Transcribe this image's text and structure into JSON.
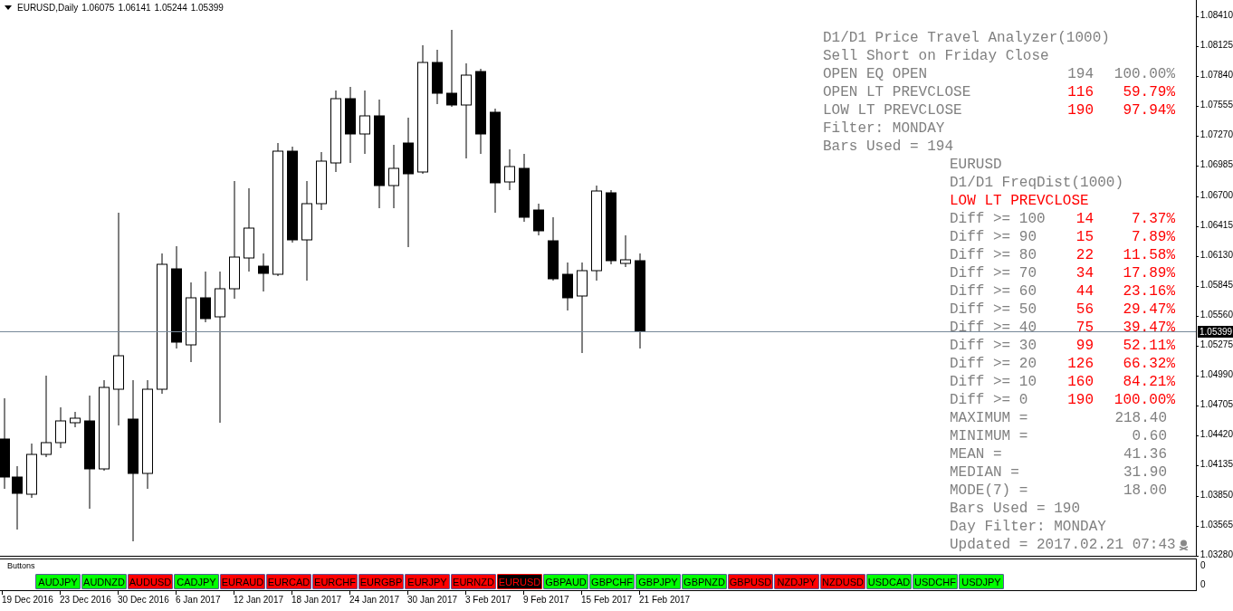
{
  "chart_window": {
    "title": "EURUSD,Daily",
    "ohlc": [
      "1.06075",
      "1.06141",
      "1.05244",
      "1.05399"
    ]
  },
  "analyzer": {
    "title": "D1/D1 Price Travel Analyzer(1000)",
    "subtitle": "Sell Short on Friday Close",
    "rows": [
      {
        "label": "OPEN EQ OPEN",
        "count": "194",
        "percent": "100.00%",
        "color": "#808080"
      },
      {
        "label": "OPEN LT PREVCLOSE",
        "count": "116",
        "percent": "59.79%",
        "color": "#ff0000"
      },
      {
        "label": "LOW LT PREVCLOSE",
        "count": "190",
        "percent": "97.94%",
        "color": "#ff0000"
      }
    ],
    "filter": "Filter: MONDAY",
    "bars_used": "Bars Used = 194"
  },
  "freq_dist": {
    "symbol": "EURUSD",
    "title": "D1/D1 FreqDist(1000)",
    "condition": "LOW LT PREVCLOSE",
    "rows": [
      {
        "label": "Diff >= 100",
        "count": "14",
        "percent": "7.37%"
      },
      {
        "label": "Diff >= 90",
        "count": "15",
        "percent": "7.89%"
      },
      {
        "label": "Diff >= 80",
        "count": "22",
        "percent": "11.58%"
      },
      {
        "label": "Diff >= 70",
        "count": "34",
        "percent": "17.89%"
      },
      {
        "label": "Diff >= 60",
        "count": "44",
        "percent": "23.16%"
      },
      {
        "label": "Diff >= 50",
        "count": "56",
        "percent": "29.47%"
      },
      {
        "label": "Diff >= 40",
        "count": "75",
        "percent": "39.47%"
      },
      {
        "label": "Diff >= 30",
        "count": "99",
        "percent": "52.11%"
      },
      {
        "label": "Diff >= 20",
        "count": "126",
        "percent": "66.32%"
      },
      {
        "label": "Diff >= 10",
        "count": "160",
        "percent": "84.21%"
      },
      {
        "label": "Diff >= 0",
        "count": "190",
        "percent": "100.00%"
      }
    ],
    "stats": [
      {
        "label": "MAXIMUM =",
        "value": "218.40"
      },
      {
        "label": "MINIMUM =",
        "value": "0.60"
      },
      {
        "label": "MEAN =",
        "value": "41.36"
      },
      {
        "label": "MEDIAN =",
        "value": "31.90"
      },
      {
        "label": "MODE(7) =",
        "value": "18.00"
      }
    ],
    "bars_used": "Bars Used = 190",
    "day_filter": "Day Filter: MONDAY",
    "updated": "Updated = 2017.02.21 07:43"
  },
  "price_axis": [
    "1.08410",
    "1.08125",
    "1.07840",
    "1.07555",
    "1.07270",
    "1.06985",
    "1.06700",
    "1.06415",
    "1.06130",
    "1.05845",
    "1.05560",
    "1.05275",
    "1.04990",
    "1.04705",
    "1.04420",
    "1.04135",
    "1.03850",
    "1.03565",
    "1.03280"
  ],
  "current_price": "1.05399",
  "buttons_window": {
    "title": "Buttons",
    "axis": [
      "0",
      "0"
    ],
    "buttons": [
      {
        "label": "AUDJPY",
        "color": "#00ff00",
        "selected": false
      },
      {
        "label": "AUDNZD",
        "color": "#00ff00",
        "selected": false
      },
      {
        "label": "AUDUSD",
        "color": "#ff0000",
        "selected": false
      },
      {
        "label": "CADJPY",
        "color": "#00ff00",
        "selected": false
      },
      {
        "label": "EURAUD",
        "color": "#ff0000",
        "selected": false
      },
      {
        "label": "EURCAD",
        "color": "#ff0000",
        "selected": false
      },
      {
        "label": "EURCHF",
        "color": "#ff0000",
        "selected": false
      },
      {
        "label": "EURGBP",
        "color": "#ff0000",
        "selected": false
      },
      {
        "label": "EURJPY",
        "color": "#ff0000",
        "selected": false
      },
      {
        "label": "EURNZD",
        "color": "#ff0000",
        "selected": false
      },
      {
        "label": "EURUSD",
        "color": "#ff0000",
        "selected": true
      },
      {
        "label": "GBPAUD",
        "color": "#00ff00",
        "selected": false
      },
      {
        "label": "GBPCHF",
        "color": "#00ff00",
        "selected": false
      },
      {
        "label": "GBPJPY",
        "color": "#00ff00",
        "selected": false
      },
      {
        "label": "GBPNZD",
        "color": "#00ff00",
        "selected": false
      },
      {
        "label": "GBPUSD",
        "color": "#ff0000",
        "selected": false
      },
      {
        "label": "NZDJPY",
        "color": "#ff0000",
        "selected": false
      },
      {
        "label": "NZDUSD",
        "color": "#ff0000",
        "selected": false
      },
      {
        "label": "USDCAD",
        "color": "#00ff00",
        "selected": false
      },
      {
        "label": "USDCHF",
        "color": "#00ff00",
        "selected": false
      },
      {
        "label": "USDJPY",
        "color": "#00ff00",
        "selected": false
      }
    ]
  },
  "date_axis": [
    "19 Dec 2016",
    "23 Dec 2016",
    "30 Dec 2016",
    "6 Jan 2017",
    "12 Jan 2017",
    "18 Jan 2017",
    "24 Jan 2017",
    "30 Jan 2017",
    "3 Feb 2017",
    "9 Feb 2017",
    "15 Feb 2017",
    "21 Feb 2017"
  ]
}
